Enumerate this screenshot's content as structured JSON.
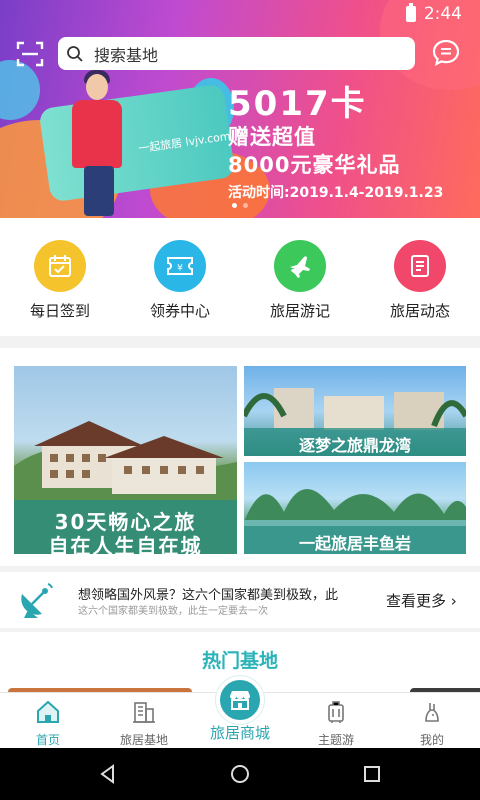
{
  "status": {
    "time": "2:44"
  },
  "search": {
    "placeholder": "搜索基地"
  },
  "banner": {
    "card_logo": "一起旅居 lvjv.com",
    "title": "5017卡",
    "line1": "赠送超值",
    "line2": "8000元豪华礼品",
    "date": "活动时间:2019.1.4-2019.1.23",
    "slides": 2,
    "active_slide": 1
  },
  "quick_nav": [
    {
      "label": "每日签到",
      "icon": "calendar-check-icon",
      "color": "#f5c32c"
    },
    {
      "label": "领券中心",
      "icon": "ticket-icon",
      "color": "#2bb6e8"
    },
    {
      "label": "旅居游记",
      "icon": "airplane-icon",
      "color": "#3cc85a"
    },
    {
      "label": "旅居动态",
      "icon": "document-icon",
      "color": "#f0476a"
    }
  ],
  "promo_tiles": {
    "big_line1": "30天畅心之旅",
    "big_line2": "自在人生自在城",
    "top_caption": "逐梦之旅鼎龙湾",
    "bottom_caption": "一起旅居丰鱼岩"
  },
  "ticker": {
    "main": "想领略国外风景？这六个国家都美到极致，此",
    "sub": "这六个国家都美到极致，此生一定要去一次",
    "more": "查看更多"
  },
  "hot": {
    "title": "热门基地"
  },
  "tabbar": {
    "home": "首页",
    "bases": "旅居基地",
    "mall": "旅居商城",
    "theme": "主题游",
    "mine": "我的"
  },
  "colors": {
    "accent": "#2aa6b0",
    "hot_title": "#2bb3b8"
  }
}
